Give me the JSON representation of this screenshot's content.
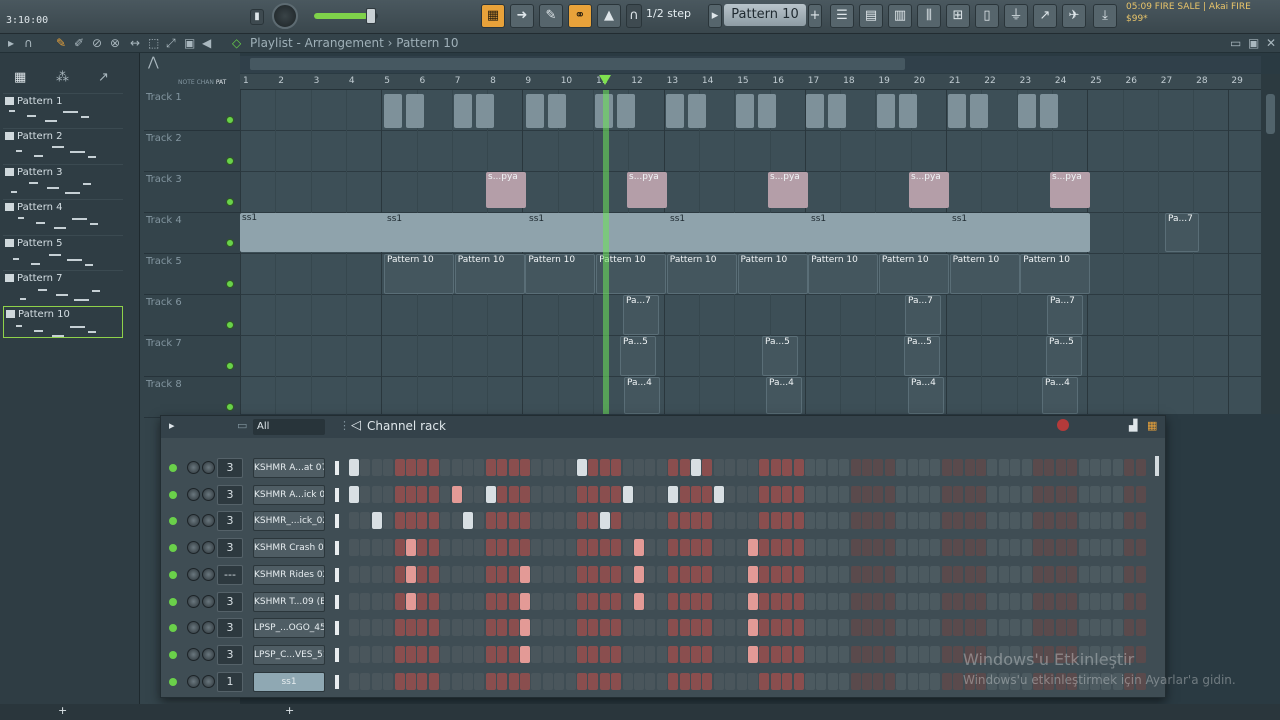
{
  "topbar": {
    "time": "3:10:00",
    "step": "1/2 step",
    "pattern": "Pattern 10",
    "news_line1": "05:09 FIRE SALE | Akai FIRE",
    "news_line2": "$99*",
    "master_volume_pct": 85
  },
  "playlist": {
    "breadcrumb": "Playlist - Arrangement › Pattern 10",
    "ruler": [
      "1",
      "2",
      "3",
      "4",
      "5",
      "6",
      "7",
      "8",
      "9",
      "10",
      "11",
      "12",
      "13",
      "14",
      "15",
      "16",
      "17",
      "18",
      "19",
      "20",
      "21",
      "22",
      "23",
      "24",
      "25",
      "26",
      "27",
      "28",
      "29"
    ],
    "tracks": [
      "Track 1",
      "Track 2",
      "Track 3",
      "Track 4",
      "Track 5",
      "Track 6",
      "Track 7",
      "Track 8"
    ],
    "clip_labels": {
      "sample": "s...pya",
      "audio": "ss1",
      "pattern": "Pattern 10",
      "pa7": "Pa...7",
      "pa5": "Pa...5",
      "pa4": "Pa...4",
      "pa7b": "Pa...7"
    }
  },
  "picker": {
    "patterns": [
      "Pattern 1",
      "Pattern 2",
      "Pattern 3",
      "Pattern 4",
      "Pattern 5",
      "Pattern 7",
      "Pattern 10"
    ],
    "header_labels": [
      "NOTE",
      "CHAN",
      "PAT"
    ]
  },
  "rack": {
    "title": "Channel rack",
    "filter": "All",
    "channels": [
      {
        "num": "3",
        "name": "KSHMR A...at 07"
      },
      {
        "num": "3",
        "name": "KSHMR A...ick 04"
      },
      {
        "num": "3",
        "name": "KSHMR_...ick_02"
      },
      {
        "num": "3",
        "name": "KSHMR Crash 05"
      },
      {
        "num": "---",
        "name": "KSHMR Rides 02"
      },
      {
        "num": "3",
        "name": "KSHMR T...09 (E)"
      },
      {
        "num": "3",
        "name": "LPSP_...OGO_45"
      },
      {
        "num": "3",
        "name": "LPSP_C...VES_51"
      },
      {
        "num": "1",
        "name": "ss1"
      }
    ]
  },
  "watermark": {
    "line1": "Windows'u Etkinleştir",
    "line2": "Windows'u etkinleştirmek için Ayarlar'a gidin."
  },
  "colors": {
    "step_red": "#8a4e4e",
    "step_dark": "#4a565c",
    "step_on_white": "#d8dfe3",
    "step_on_pink": "#e39a96",
    "step_faded": "#5a4a4c"
  }
}
